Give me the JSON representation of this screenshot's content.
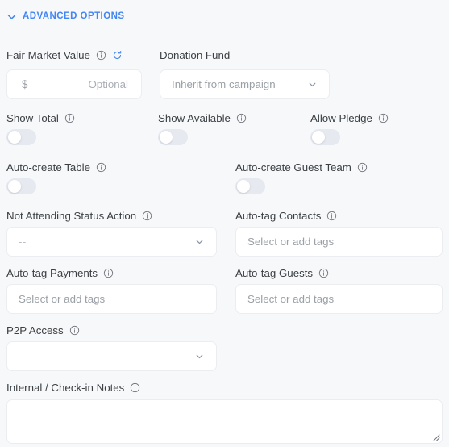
{
  "section": {
    "title": "ADVANCED OPTIONS",
    "chevron_icon": "chevron-down-icon",
    "accent_color": "#4285F4"
  },
  "theme": {
    "background": "#F7F8FA",
    "field_background": "#FFFFFF",
    "field_border": "#EBEDF1",
    "label_color": "#3C4043",
    "placeholder_color": "#9AA0A6",
    "toggle_track_off": "#E7E9F1",
    "toggle_knob": "#FFFFFF"
  },
  "fields": {
    "fair_market_value": {
      "label": "Fair Market Value",
      "info_icon": "info-icon",
      "refresh_icon": "refresh-icon",
      "currency_prefix": "$",
      "placeholder": "Optional",
      "value": ""
    },
    "donation_fund": {
      "label": "Donation Fund",
      "selected": "Inherit from campaign",
      "caret_icon": "chevron-down-icon"
    },
    "show_total": {
      "label": "Show Total",
      "info_icon": "info-icon",
      "state": "off"
    },
    "show_available": {
      "label": "Show Available",
      "info_icon": "info-icon",
      "state": "off"
    },
    "allow_pledge": {
      "label": "Allow Pledge",
      "info_icon": "info-icon",
      "state": "off"
    },
    "auto_create_table": {
      "label": "Auto-create Table",
      "info_icon": "info-icon",
      "state": "off"
    },
    "auto_create_guest_team": {
      "label": "Auto-create Guest Team",
      "info_icon": "info-icon",
      "state": "off"
    },
    "not_attending_status_action": {
      "label": "Not Attending Status Action",
      "info_icon": "info-icon",
      "selected": "--",
      "caret_icon": "chevron-down-icon"
    },
    "auto_tag_contacts": {
      "label": "Auto-tag Contacts",
      "info_icon": "info-icon",
      "placeholder": "Select or add tags",
      "value": ""
    },
    "auto_tag_payments": {
      "label": "Auto-tag Payments",
      "info_icon": "info-icon",
      "placeholder": "Select or add tags",
      "value": ""
    },
    "auto_tag_guests": {
      "label": "Auto-tag Guests",
      "info_icon": "info-icon",
      "placeholder": "Select or add tags",
      "value": ""
    },
    "p2p_access": {
      "label": "P2P Access",
      "info_icon": "info-icon",
      "selected": "--",
      "caret_icon": "chevron-down-icon"
    },
    "internal_checkin_notes": {
      "label": "Internal / Check-in Notes",
      "info_icon": "info-icon",
      "value": "",
      "resize_handle_icon": "resize-grip-icon"
    }
  }
}
